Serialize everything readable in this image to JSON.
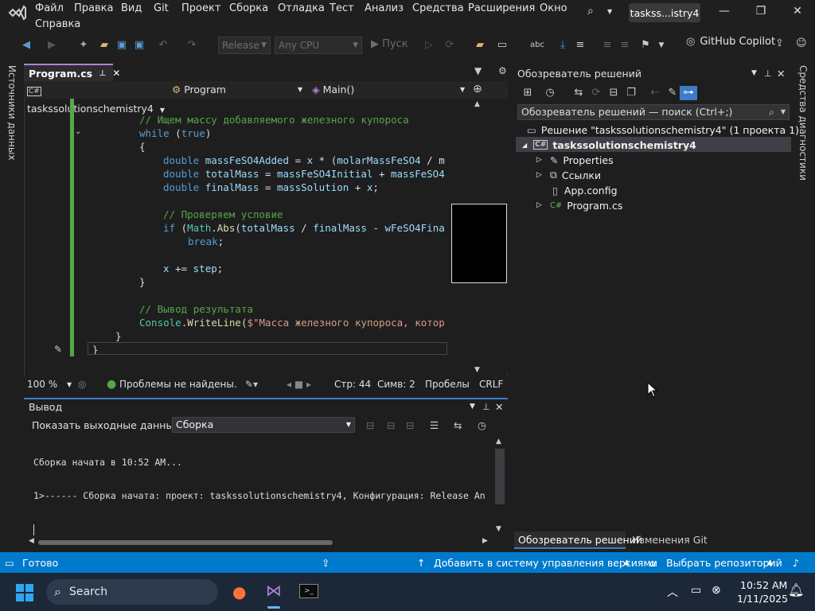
{
  "menu": {
    "items": [
      "Файл",
      "Правка",
      "Вид",
      "Git",
      "Проект",
      "Сборка",
      "Отладка",
      "Тест",
      "Анализ",
      "Средства",
      "Расширения",
      "Окно",
      "Справка"
    ],
    "window_title": "taskss...istry4"
  },
  "toolbar": {
    "config_combo": "Release",
    "platform_combo": "Any CPU",
    "run_label": "Пуск",
    "copilot_label": "GitHub Copilot"
  },
  "left_strip": {
    "label": "Источники данных"
  },
  "right_strip": {
    "label": "Средства диагностики"
  },
  "editor": {
    "tab_label": "Program.cs",
    "nav_project": "taskssolutionschemistry4",
    "nav_class": "Program",
    "nav_member": "Main()",
    "zoom": "100 %",
    "problems": "Проблемы не найдены.",
    "line": "Стр: 44",
    "col": "Симв: 2",
    "spaces": "Пробелы",
    "eol": "CRLF"
  },
  "code_lines": [
    {
      "tokens": [
        [
          "cm",
          "// Ищем массу добавляемого железного купороса"
        ]
      ]
    },
    {
      "tokens": [
        [
          "kw",
          "while"
        ],
        [
          "pl",
          " ("
        ],
        [
          "kw",
          "true"
        ],
        [
          "pl",
          ")"
        ]
      ]
    },
    {
      "tokens": [
        [
          "pl",
          "{"
        ]
      ]
    },
    {
      "tokens": [
        [
          "kw",
          "double"
        ],
        [
          "pl",
          " "
        ],
        [
          "var",
          "massFeSO4Added"
        ],
        [
          "pl",
          " = "
        ],
        [
          "var",
          "x"
        ],
        [
          "pl",
          " * ("
        ],
        [
          "var",
          "molarMassFeSO4"
        ],
        [
          "pl",
          " / m"
        ]
      ]
    },
    {
      "tokens": [
        [
          "kw",
          "double"
        ],
        [
          "pl",
          " "
        ],
        [
          "var",
          "totalMass"
        ],
        [
          "pl",
          " = "
        ],
        [
          "var",
          "massFeSO4Initial"
        ],
        [
          "pl",
          " + "
        ],
        [
          "var",
          "massFeSO4"
        ]
      ]
    },
    {
      "tokens": [
        [
          "kw",
          "double"
        ],
        [
          "pl",
          " "
        ],
        [
          "var",
          "finalMass"
        ],
        [
          "pl",
          " = "
        ],
        [
          "var",
          "massSolution"
        ],
        [
          "pl",
          " + "
        ],
        [
          "var",
          "x"
        ],
        [
          "pl",
          ";"
        ]
      ]
    },
    {
      "tokens": [
        [
          "pl",
          ""
        ]
      ]
    },
    {
      "tokens": [
        [
          "cm",
          "// Проверяем условие"
        ]
      ]
    },
    {
      "tokens": [
        [
          "kw",
          "if"
        ],
        [
          "pl",
          " ("
        ],
        [
          "ty",
          "Math"
        ],
        [
          "pl",
          "."
        ],
        [
          "fn",
          "Abs"
        ],
        [
          "pl",
          "("
        ],
        [
          "var",
          "totalMass"
        ],
        [
          "pl",
          " / "
        ],
        [
          "var",
          "finalMass"
        ],
        [
          "pl",
          " - "
        ],
        [
          "var",
          "wFeSO4Fina"
        ]
      ]
    },
    {
      "tokens": [
        [
          "kw",
          "break"
        ],
        [
          "pl",
          ";"
        ]
      ]
    },
    {
      "tokens": [
        [
          "pl",
          ""
        ]
      ]
    },
    {
      "tokens": [
        [
          "var",
          "x"
        ],
        [
          "pl",
          " += "
        ],
        [
          "var",
          "step"
        ],
        [
          "pl",
          ";"
        ]
      ]
    },
    {
      "tokens": [
        [
          "pl",
          "}"
        ]
      ]
    },
    {
      "tokens": [
        [
          "pl",
          ""
        ]
      ]
    },
    {
      "tokens": [
        [
          "cm",
          "// Вывод результата"
        ]
      ]
    },
    {
      "tokens": [
        [
          "ty",
          "Console"
        ],
        [
          "pl",
          "."
        ],
        [
          "fn",
          "WriteLine"
        ],
        [
          "pl",
          "("
        ],
        [
          "str",
          "$\"Масса железного купороса, котор"
        ]
      ]
    },
    {
      "tokens": [
        [
          "pl",
          "}"
        ]
      ]
    },
    {
      "tokens": [
        [
          "pl",
          "}"
        ]
      ]
    }
  ],
  "output": {
    "title": "Вывод",
    "show_label": "Показать выходные данные из:",
    "source": "Сборка",
    "lines": [
      "Сборка начата в 10:52 AM...",
      "1>------ Сборка начата: проект: taskssolutionschemistry4, Конфигурация: Release An"
    ]
  },
  "solution_explorer": {
    "title": "Обозреватель решений",
    "search_placeholder": "Обозреватель решений — поиск (Ctrl+;)",
    "solution": "Решение \"taskssolutionschemistry4\" (1 проекта 1)",
    "project": "taskssolutionschemistry4",
    "items": [
      "Properties",
      "Ссылки",
      "App.config",
      "Program.cs"
    ],
    "bottom_tabs": [
      "Обозреватель решений",
      "Изменения Git"
    ]
  },
  "statusbar": {
    "ready": "Готово",
    "add_vcs": "Добавить в систему управления версиями",
    "select_repo": "Выбрать репозиторий"
  },
  "taskbar": {
    "search": "Search",
    "time": "10:52 AM",
    "date": "1/11/2025"
  }
}
